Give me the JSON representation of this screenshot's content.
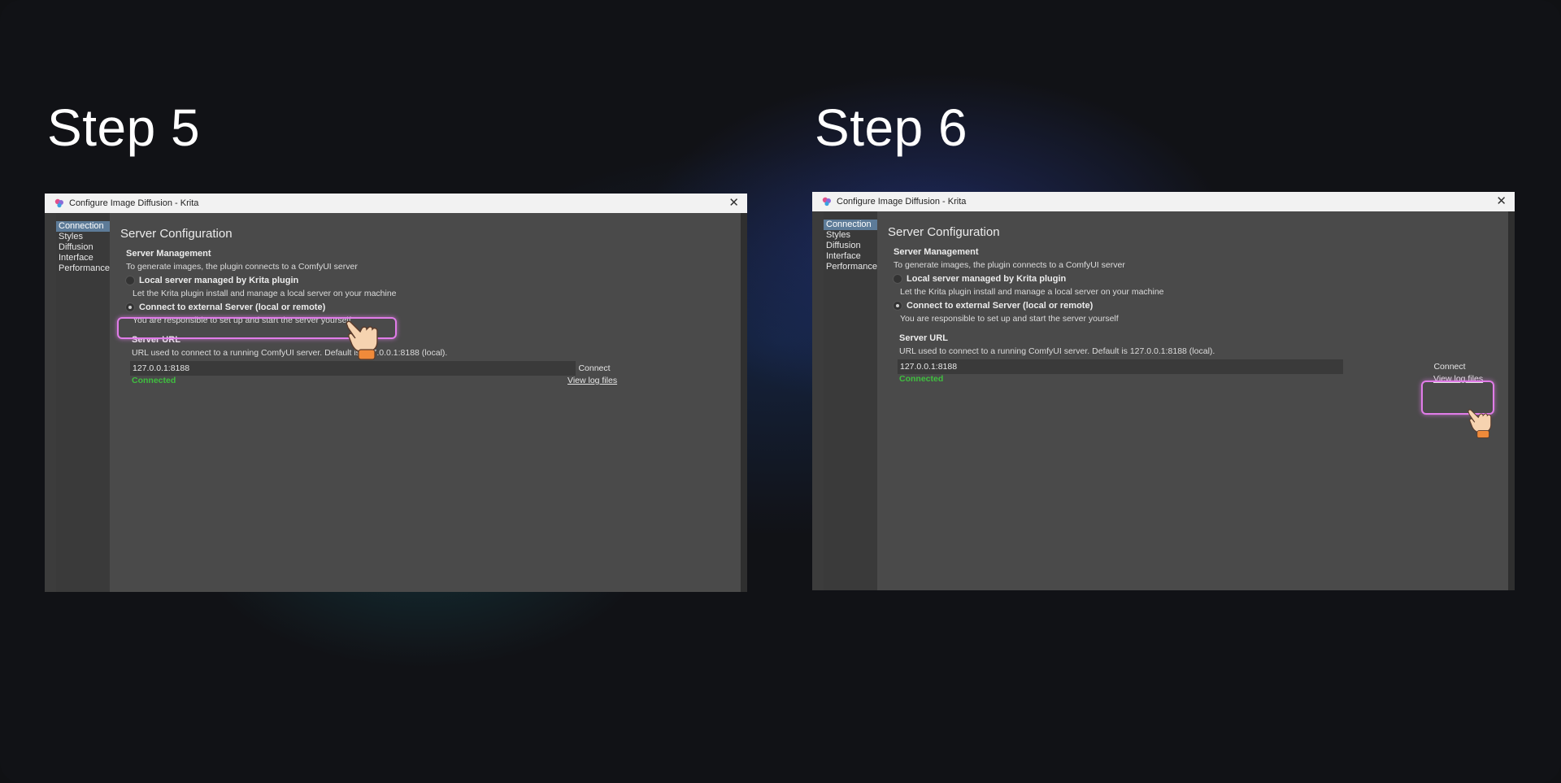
{
  "steps": [
    {
      "title": "Step 5",
      "window": {
        "title": "Configure Image Diffusion - Krita",
        "nav": [
          "Connection",
          "Styles",
          "Diffusion",
          "Interface",
          "Performance"
        ],
        "heading": "Server Configuration",
        "section_title": "Server Management",
        "section_desc": "To generate images, the plugin connects to a ComfyUI server",
        "option_local_label": "Local server managed by Krita plugin",
        "option_local_desc": "Let the Krita plugin install and manage a local server on your machine",
        "option_external_label": "Connect to external Server (local or remote)",
        "option_external_desc": "You are responsible to set up and start the server yourself",
        "url_title": "Server URL",
        "url_desc": "URL used to connect to a running ComfyUI server. Default is 127.0.0.1:8188 (local).",
        "url_value": "127.0.0.1:8188",
        "connect_label": "Connect",
        "status": "Connected",
        "log_link": "View log files"
      }
    },
    {
      "title": "Step 6",
      "window": {
        "title": "Configure Image Diffusion - Krita",
        "nav": [
          "Connection",
          "Styles",
          "Diffusion",
          "Interface",
          "Performance"
        ],
        "heading": "Server Configuration",
        "section_title": "Server Management",
        "section_desc": "To generate images, the plugin connects to a ComfyUI server",
        "option_local_label": "Local server managed by Krita plugin",
        "option_local_desc": "Let the Krita plugin install and manage a local server on your machine",
        "option_external_label": "Connect to external Server (local or remote)",
        "option_external_desc": "You are responsible to set up and start the server yourself",
        "url_title": "Server URL",
        "url_desc": "URL used to connect to a running ComfyUI server. Default is 127.0.0.1:8188 (local).",
        "url_value": "127.0.0.1:8188",
        "connect_label": "Connect",
        "status": "Connected",
        "log_link": "View log files"
      }
    }
  ],
  "icons": {
    "app": "krita-icon",
    "close": "close-icon",
    "pointer": "pointing-hand-icon"
  },
  "colors": {
    "highlight": "#e07ce8",
    "status_connected": "#3fbf3f",
    "nav_active": "#5d7b98"
  }
}
